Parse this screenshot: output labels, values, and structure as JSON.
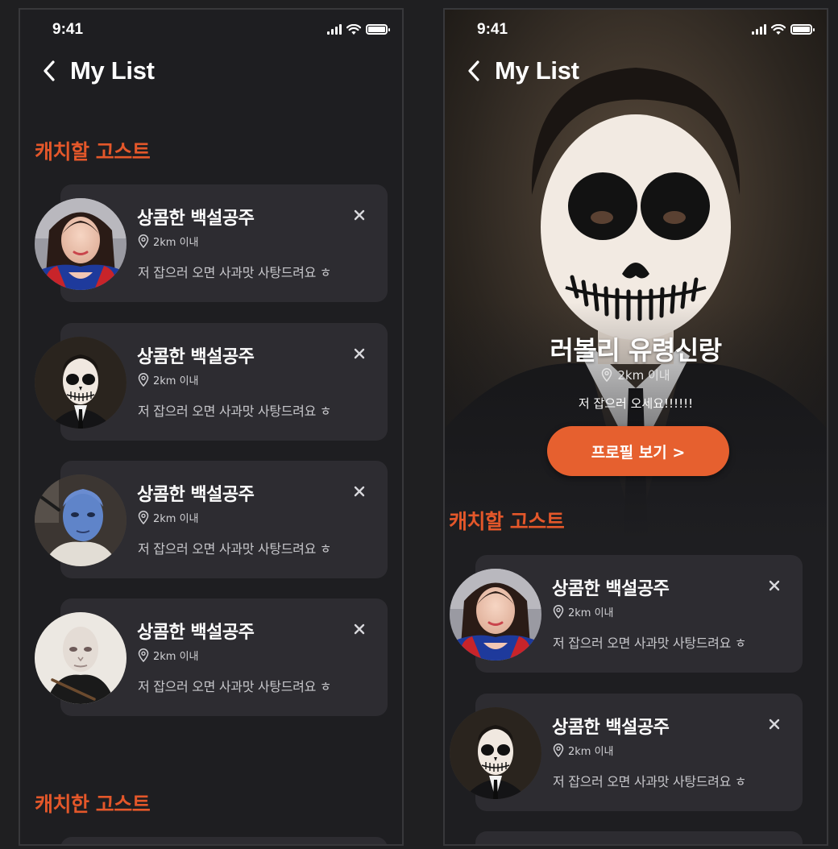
{
  "status": {
    "time": "9:41"
  },
  "nav": {
    "title": "My List"
  },
  "sections": {
    "to_catch": "캐치할 고스트",
    "caught": "캐치한 고스트"
  },
  "card": {
    "name": "상콤한 백설공주",
    "distance": "2km 이내",
    "message": "저 잡으러 오면 사과맛 사탕드려요 ㅎ"
  },
  "left_cards": [
    {
      "avatar": "snow-white-photo"
    },
    {
      "avatar": "skull-makeup-photo"
    },
    {
      "avatar": "blue-face-makeup-photo"
    },
    {
      "avatar": "voldemort-costume-photo"
    }
  ],
  "featured": {
    "name": "러볼리 유령신랑",
    "distance": "2km 이내",
    "message": "저 잡으러 오세요!!!!!!",
    "button": "프로필 보기 >"
  },
  "colors": {
    "accent": "#e4572a",
    "card": "#2d2c31",
    "background": "#1e1e21"
  }
}
